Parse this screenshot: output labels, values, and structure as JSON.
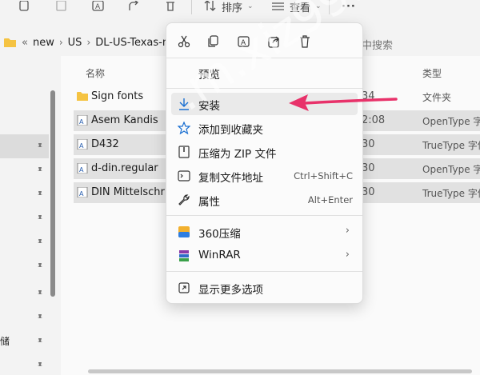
{
  "toolbar": {
    "sort_label": "排序",
    "view_label": "查看",
    "more_label": "···"
  },
  "address": {
    "prefix": "«",
    "crumbs": [
      "new",
      "US",
      "DL-US-Texas-nev"
    ],
    "search_placeholder": "中搜索"
  },
  "columns": {
    "name": "名称",
    "type": "类型"
  },
  "files": [
    {
      "name": "Sign fonts",
      "date": "34",
      "type": "文件夹",
      "kind": "folder",
      "selected": false
    },
    {
      "name": "Asem Kandis",
      "date": "2:08",
      "type": "OpenType 字体",
      "kind": "font",
      "selected": true
    },
    {
      "name": "D432",
      "date": "30",
      "type": "TrueType 字体",
      "kind": "font",
      "selected": true
    },
    {
      "name": "d-din.regular",
      "date": "30",
      "type": "OpenType 字体",
      "kind": "font",
      "selected": true
    },
    {
      "name": "DIN Mittelschrift",
      "date": "30",
      "type": "TrueType 字体",
      "kind": "font",
      "selected": true
    }
  ],
  "nav": {
    "partial_text": "储"
  },
  "context_menu": {
    "quick_actions": [
      "cut-icon",
      "copy-icon",
      "rename-icon",
      "share-icon",
      "delete-icon"
    ],
    "items": [
      {
        "label": "预览",
        "icon": "",
        "shortcut": ""
      },
      {
        "label": "安装",
        "icon": "download-icon",
        "shortcut": ""
      },
      {
        "label": "添加到收藏夹",
        "icon": "star-icon",
        "shortcut": ""
      },
      {
        "label": "压缩为 ZIP 文件",
        "icon": "zip-icon",
        "shortcut": ""
      },
      {
        "label": "复制文件地址",
        "icon": "path-icon",
        "shortcut": "Ctrl+Shift+C"
      },
      {
        "label": "属性",
        "icon": "wrench-icon",
        "shortcut": "Alt+Enter"
      },
      {
        "label": "360压缩",
        "icon": "archive-360-icon",
        "submenu": true
      },
      {
        "label": "WinRAR",
        "icon": "winrar-icon",
        "submenu": true
      },
      {
        "label": "显示更多选项",
        "icon": "more-options-icon",
        "shortcut": ""
      }
    ]
  },
  "colors": {
    "accent": "#1a6fd1",
    "annotation_arrow": "#e8326a"
  }
}
